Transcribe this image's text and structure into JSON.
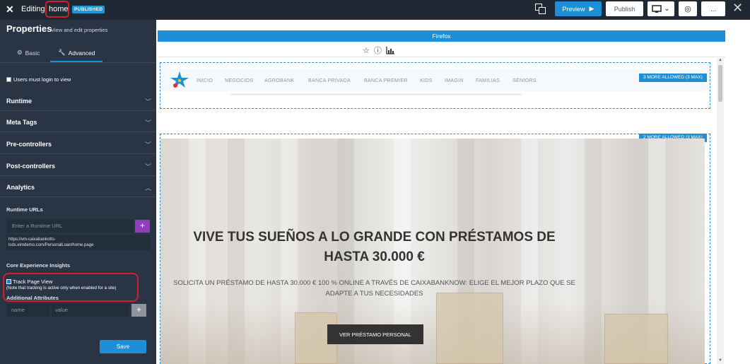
{
  "topbar": {
    "editing_label": "Editing:",
    "page_name": "home",
    "status_badge": "PUBLISHED",
    "preview_label": "Preview",
    "publish_label": "Publish",
    "more_label": "..."
  },
  "panel": {
    "title": "Properties",
    "subtitle": "View and edit properties",
    "tabs": [
      {
        "label": "Basic",
        "icon": "gear-icon",
        "active": false
      },
      {
        "label": "Advanced",
        "icon": "wrench-icon",
        "active": true
      }
    ],
    "users_login": "Users must login to view",
    "sections": [
      "Runtime",
      "Meta Tags",
      "Pre-controllers",
      "Post-controllers",
      "Analytics"
    ],
    "runtime_urls_label": "Runtime URLs",
    "runtime_url_placeholder": "Enter a Runtime URL",
    "runtime_url_value_1": "https://vm-caixabankotts-",
    "runtime_url_value_2": "lsds.eimdemo.com/PersonalLoan/home.page",
    "core_label": "Core Experience Insights",
    "track_label": "Track Page View",
    "track_note": "(Note that tracking is active only when enabled for a site)",
    "attributes_label": "Additional Attributes",
    "attr_name_placeholder": "name",
    "attr_value_placeholder": "value",
    "save_label": "Save"
  },
  "preview": {
    "browser_label": "Firefox",
    "nav_items": [
      "INICIO",
      "NEGOCIOS",
      "AGROBANK",
      "BANCA PRIVADA",
      "BANCA PREMIER",
      "KIDS",
      "IMAGIN",
      "FAMILIAS",
      "SÉNIORS"
    ],
    "zone_top_tag": "3 MORE ALLOWED (3 MAX)",
    "zone_hero_tag": "2 MORE ALLOWED (3 MAX)",
    "hero_title_1": "VIVE TUS SUEÑOS A LO GRANDE CON PRÉSTAMOS DE",
    "hero_title_2": "HASTA 30.000 €",
    "hero_sub_1": "SOLICITA UN PRÉSTAMO DE HASTA 30.000 € 100 % ONLINE A TRAVÉS DE CAIXABANKNOW: ELIGE EL MEJOR PLAZO QUE SE",
    "hero_sub_2": "ADAPTE A TUS NECESIDADES",
    "hero_button": "VER PRÉSTAMO PERSONAL"
  },
  "colors": {
    "accent": "#1e8fd6",
    "panel_bg": "#293544",
    "topbar_bg": "#1f2833",
    "highlight": "#d0202b",
    "add_button": "#8d3fb8"
  }
}
